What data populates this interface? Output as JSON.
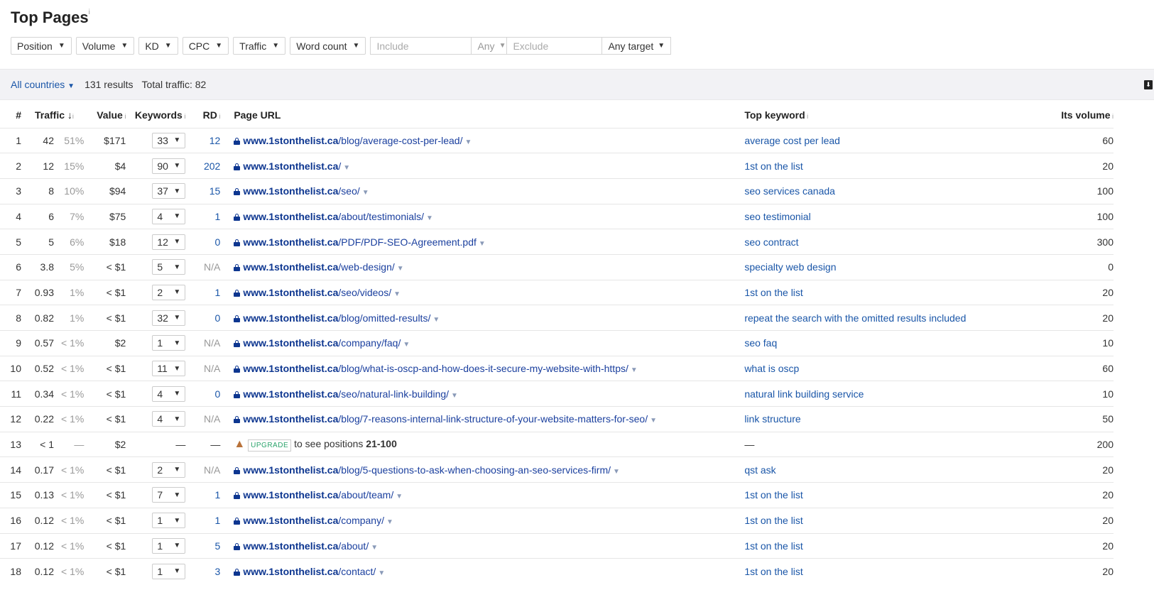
{
  "title": "Top Pages",
  "info": "i",
  "filters": [
    "Position",
    "Volume",
    "KD",
    "CPC",
    "Traffic",
    "Word count"
  ],
  "include_placeholder": "Include",
  "include_mode": "Any",
  "exclude_placeholder": "Exclude",
  "target": "Any target",
  "summary": {
    "country": "All countries",
    "results": "131 results",
    "total_traffic": "Total traffic: 82"
  },
  "columns": {
    "num": "#",
    "traffic": "Traffic",
    "value": "Value",
    "keywords": "Keywords",
    "rd": "RD",
    "url": "Page URL",
    "top_keyword": "Top keyword",
    "volume": "Its volume"
  },
  "domain": "www.1stonthelist.ca",
  "upgrade": {
    "badge": "UPGRADE",
    "text": "to see positions ",
    "range": "21-100"
  },
  "rows": [
    {
      "n": "1",
      "traffic": "42",
      "pct": "51%",
      "value": "$171",
      "kw": "33",
      "rd": "12",
      "path": "/blog/average-cost-per-lead/",
      "top": "average cost per lead",
      "vol": "60"
    },
    {
      "n": "2",
      "traffic": "12",
      "pct": "15%",
      "value": "$4",
      "kw": "90",
      "rd": "202",
      "path": "/",
      "top": "1st on the list",
      "vol": "20"
    },
    {
      "n": "3",
      "traffic": "8",
      "pct": "10%",
      "value": "$94",
      "kw": "37",
      "rd": "15",
      "path": "/seo/",
      "top": "seo services canada",
      "vol": "100"
    },
    {
      "n": "4",
      "traffic": "6",
      "pct": "7%",
      "value": "$75",
      "kw": "4",
      "rd": "1",
      "path": "/about/testimonials/",
      "top": "seo testimonial",
      "vol": "100"
    },
    {
      "n": "5",
      "traffic": "5",
      "pct": "6%",
      "value": "$18",
      "kw": "12",
      "rd": "0",
      "path": "/PDF/PDF-SEO-Agreement.pdf",
      "top": "seo contract",
      "vol": "300"
    },
    {
      "n": "6",
      "traffic": "3.8",
      "pct": "5%",
      "value": "< $1",
      "kw": "5",
      "rd": "N/A",
      "path": "/web-design/",
      "top": "specialty web design",
      "vol": "0"
    },
    {
      "n": "7",
      "traffic": "0.93",
      "pct": "1%",
      "value": "< $1",
      "kw": "2",
      "rd": "1",
      "path": "/seo/videos/",
      "top": "1st on the list",
      "vol": "20"
    },
    {
      "n": "8",
      "traffic": "0.82",
      "pct": "1%",
      "value": "< $1",
      "kw": "32",
      "rd": "0",
      "path": "/blog/omitted-results/",
      "top": "repeat the search with the omitted results included",
      "vol": "20"
    },
    {
      "n": "9",
      "traffic": "0.57",
      "pct": "< 1%",
      "value": "$2",
      "kw": "1",
      "rd": "N/A",
      "path": "/company/faq/",
      "top": "seo faq",
      "vol": "10"
    },
    {
      "n": "10",
      "traffic": "0.52",
      "pct": "< 1%",
      "value": "< $1",
      "kw": "11",
      "rd": "N/A",
      "path": "/blog/what-is-oscp-and-how-does-it-secure-my-website-with-https/",
      "top": "what is oscp",
      "vol": "60"
    },
    {
      "n": "11",
      "traffic": "0.34",
      "pct": "< 1%",
      "value": "< $1",
      "kw": "4",
      "rd": "0",
      "path": "/seo/natural-link-building/",
      "top": "natural link building service",
      "vol": "10"
    },
    {
      "n": "12",
      "traffic": "0.22",
      "pct": "< 1%",
      "value": "< $1",
      "kw": "4",
      "rd": "N/A",
      "path": "/blog/7-reasons-internal-link-structure-of-your-website-matters-for-seo/",
      "top": "link structure",
      "vol": "50"
    },
    {
      "n": "13",
      "traffic": "< 1",
      "pct": "—",
      "value": "$2",
      "kw": "—",
      "rd": "—",
      "upgrade": true,
      "top": "—",
      "vol": "200"
    },
    {
      "n": "14",
      "traffic": "0.17",
      "pct": "< 1%",
      "value": "< $1",
      "kw": "2",
      "rd": "N/A",
      "path": "/blog/5-questions-to-ask-when-choosing-an-seo-services-firm/",
      "top": "qst ask",
      "vol": "20"
    },
    {
      "n": "15",
      "traffic": "0.13",
      "pct": "< 1%",
      "value": "< $1",
      "kw": "7",
      "rd": "1",
      "path": "/about/team/",
      "top": "1st on the list",
      "vol": "20"
    },
    {
      "n": "16",
      "traffic": "0.12",
      "pct": "< 1%",
      "value": "< $1",
      "kw": "1",
      "rd": "1",
      "path": "/company/",
      "top": "1st on the list",
      "vol": "20"
    },
    {
      "n": "17",
      "traffic": "0.12",
      "pct": "< 1%",
      "value": "< $1",
      "kw": "1",
      "rd": "5",
      "path": "/about/",
      "top": "1st on the list",
      "vol": "20"
    },
    {
      "n": "18",
      "traffic": "0.12",
      "pct": "< 1%",
      "value": "< $1",
      "kw": "1",
      "rd": "3",
      "path": "/contact/",
      "top": "1st on the list",
      "vol": "20"
    }
  ]
}
